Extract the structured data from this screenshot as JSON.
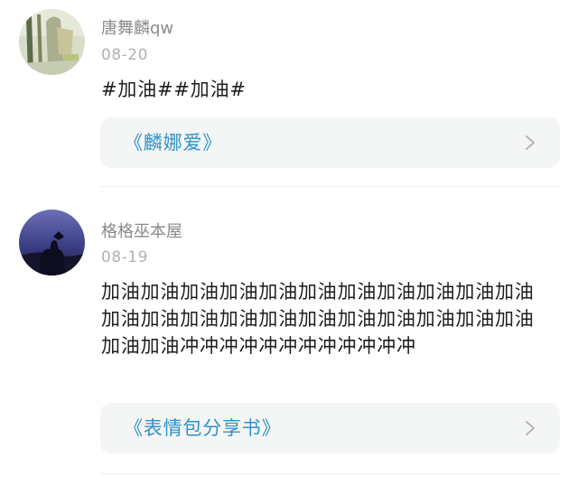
{
  "posts": [
    {
      "avatar_icon": "avatar-image-icon",
      "username": "唐舞麟qw",
      "date": "08-20",
      "content": "#加油##加油#",
      "link_label": "《麟娜爱》",
      "chevron_icon": "chevron-right-icon"
    },
    {
      "avatar_icon": "avatar-image-icon",
      "username": "格格巫本屋",
      "date": "08-19",
      "content": "加油加油加油加油加油加油加油加油加油加油加油加油加油加油加油加油加油加油加油加油加油加油加油加油冲冲冲冲冲冲冲冲冲冲冲冲",
      "link_label": "《表情包分享书》",
      "chevron_icon": "chevron-right-icon"
    }
  ],
  "colors": {
    "link": "#2f93c8",
    "card_bg": "#f4f5f5",
    "username": "#8a8a8a",
    "date": "#b2b2b2",
    "body": "#1e1e1e"
  }
}
